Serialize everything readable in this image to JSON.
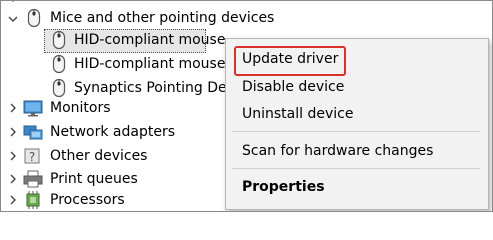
{
  "tree": {
    "category_mice": {
      "label": "Mice and other pointing devices"
    },
    "devices": [
      {
        "label": "HID-compliant mouse"
      },
      {
        "label": "HID-compliant mouse"
      },
      {
        "label": "Synaptics Pointing Device"
      }
    ],
    "collapsed": [
      {
        "label": "Monitors",
        "icon": "monitor-icon"
      },
      {
        "label": "Network adapters",
        "icon": "network-adapter-icon"
      },
      {
        "label": "Other devices",
        "icon": "unknown-device-icon"
      },
      {
        "label": "Print queues",
        "icon": "printer-icon"
      },
      {
        "label": "Processors",
        "icon": "processor-icon"
      }
    ]
  },
  "context_menu": {
    "update_driver": "Update driver",
    "disable_device": "Disable device",
    "uninstall_device": "Uninstall device",
    "scan_hardware": "Scan for hardware changes",
    "properties": "Properties"
  },
  "colors": {
    "highlight_border": "#d9312a",
    "menu_background": "#f2f2f2"
  }
}
